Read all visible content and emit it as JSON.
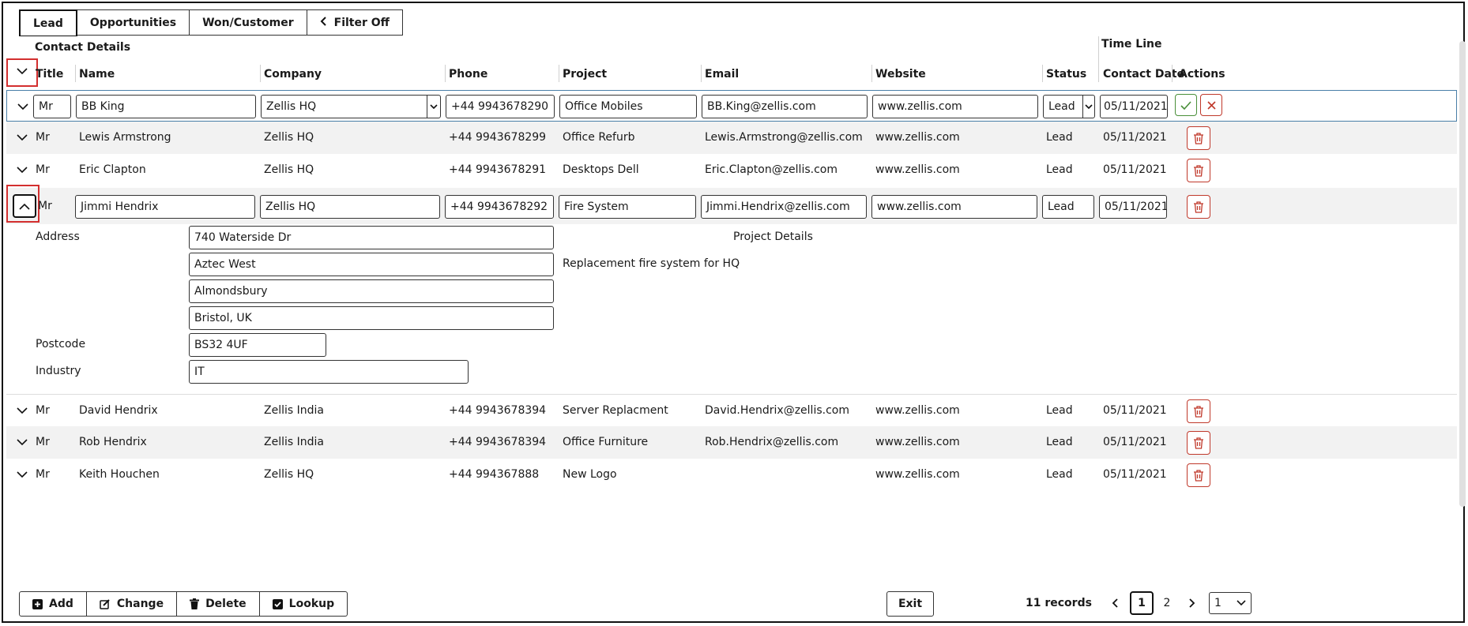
{
  "tabs": [
    "Lead",
    "Opportunities",
    "Won/Customer",
    "Filter Off"
  ],
  "header": {
    "group_contact": "Contact Details",
    "group_timeline": "Time Line",
    "columns": {
      "title": "Title",
      "name": "Name",
      "company": "Company",
      "phone": "Phone",
      "project": "Project",
      "email": "Email",
      "website": "Website",
      "status": "Status",
      "contact_date": "Contact Date",
      "actions": "Actions"
    }
  },
  "edit_row": {
    "title": "Mr",
    "name": "BB King",
    "company": "Zellis HQ",
    "phone": "+44 9943678290",
    "project": "Office Mobiles",
    "email": "BB.King@zellis.com",
    "website": "www.zellis.com",
    "status": "Lead",
    "contact_date": "05/11/2021"
  },
  "rows_top": [
    {
      "title": "Mr",
      "name": "Lewis Armstrong",
      "company": "Zellis HQ",
      "phone": "+44 9943678299",
      "project": "Office Refurb",
      "email": "Lewis.Armstrong@zellis.com",
      "website": "www.zellis.com",
      "status": "Lead",
      "contact_date": "05/11/2021"
    },
    {
      "title": "Mr",
      "name": "Eric Clapton",
      "company": "Zellis HQ",
      "phone": "+44 9943678291",
      "project": "Desktops Dell",
      "email": "Eric.Clapton@zellis.com",
      "website": "www.zellis.com",
      "status": "Lead",
      "contact_date": "05/11/2021"
    }
  ],
  "expanded_row": {
    "title": "Mr",
    "name": "Jimmi Hendrix",
    "company": "Zellis HQ",
    "phone": "+44 9943678292",
    "project": "Fire System",
    "email": "Jimmi.Hendrix@zellis.com",
    "website": "www.zellis.com",
    "status": "Lead",
    "contact_date": "05/11/2021",
    "details": {
      "address_label": "Address",
      "address_lines": [
        "740 Waterside Dr",
        "Aztec West",
        "Almondsbury",
        "Bristol, UK"
      ],
      "postcode_label": "Postcode",
      "postcode": "BS32 4UF",
      "industry_label": "Industry",
      "industry": "IT",
      "project_details_label": "Project Details",
      "project_details": "Replacement fire system for HQ"
    }
  },
  "rows_bottom": [
    {
      "title": "Mr",
      "name": "David Hendrix",
      "company": "Zellis India",
      "phone": "+44 9943678394",
      "project": "Server Replacment",
      "email": "David.Hendrix@zellis.com",
      "website": "www.zellis.com",
      "status": "Lead",
      "contact_date": "05/11/2021"
    },
    {
      "title": "Mr",
      "name": "Rob Hendrix",
      "company": "Zellis India",
      "phone": "+44 9943678394",
      "project": "Office Furniture",
      "email": "Rob.Hendrix@zellis.com",
      "website": "www.zellis.com",
      "status": "Lead",
      "contact_date": "05/11/2021"
    },
    {
      "title": "Mr",
      "name": "Keith Houchen",
      "company": "Zellis HQ",
      "phone": "+44 994367888",
      "project": "New Logo",
      "email": "",
      "website": "www.zellis.com",
      "status": "Lead",
      "contact_date": "05/11/2021"
    }
  ],
  "footer": {
    "add": "Add",
    "change": "Change",
    "delete": "Delete",
    "lookup": "Lookup",
    "exit": "Exit",
    "records": "11 records",
    "pages": [
      "1",
      "2"
    ],
    "page_size": "1"
  },
  "colors": {
    "accent_red": "#c0392b",
    "accent_green": "#4a8f3a",
    "highlight": "#d32f2f"
  }
}
